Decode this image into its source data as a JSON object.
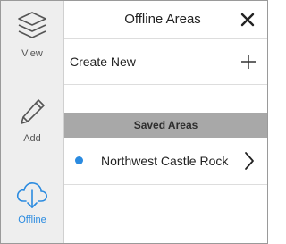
{
  "sidebar": {
    "items": [
      {
        "label": "View",
        "icon": "layers-icon",
        "active": false
      },
      {
        "label": "Add",
        "icon": "pencil-icon",
        "active": false
      },
      {
        "label": "Offline",
        "icon": "cloud-download-icon",
        "active": true
      }
    ]
  },
  "header": {
    "title": "Offline Areas",
    "close_icon": "close-icon"
  },
  "create_row": {
    "label": "Create New",
    "icon": "plus-icon"
  },
  "saved_section": {
    "title": "Saved Areas"
  },
  "saved_areas": [
    {
      "name": "Northwest Castle Rock",
      "status_color": "#2b8be0",
      "icon": "chevron-right-icon"
    }
  ],
  "colors": {
    "accent": "#2b8be0",
    "section_header_bg": "#a8a8a8",
    "sidebar_bg": "#eeeeee"
  }
}
